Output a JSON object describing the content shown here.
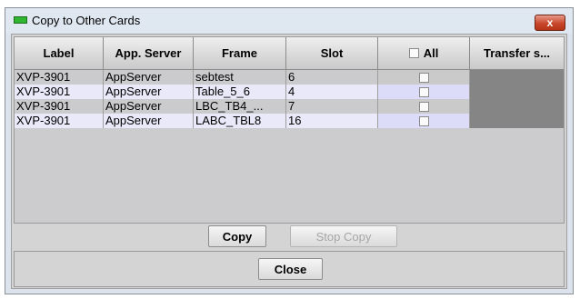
{
  "window": {
    "title": "Copy to Other Cards",
    "close_glyph": "x"
  },
  "table": {
    "columns": {
      "label": "Label",
      "app_server": "App. Server",
      "frame": "Frame",
      "slot": "Slot",
      "all": "All",
      "transfer": "Transfer s..."
    },
    "select_all_checked": false,
    "rows": [
      {
        "label": "XVP-3901",
        "app_server": "AppServer",
        "frame": "sebtest",
        "slot": "6",
        "selected": false
      },
      {
        "label": "XVP-3901",
        "app_server": "AppServer",
        "frame": "Table_5_6",
        "slot": "4",
        "selected": false
      },
      {
        "label": "XVP-3901",
        "app_server": "AppServer",
        "frame": "LBC_TB4_...",
        "slot": "7",
        "selected": false
      },
      {
        "label": "XVP-3901",
        "app_server": "AppServer",
        "frame": "LABC_TBL8",
        "slot": "16",
        "selected": false
      }
    ],
    "row_colors": {
      "odd": "#cbcbcd",
      "even": "#e9e9f9",
      "checkbox_odd": "#cacaca",
      "checkbox_even": "#dcdcf8",
      "transfer_cell": "#858585"
    }
  },
  "actions": {
    "copy_label": "Copy",
    "stop_copy_label": "Stop Copy",
    "stop_copy_enabled": false,
    "close_label": "Close"
  },
  "icons": {
    "window_icon": "green-card-icon",
    "close_icon": "close-icon"
  }
}
